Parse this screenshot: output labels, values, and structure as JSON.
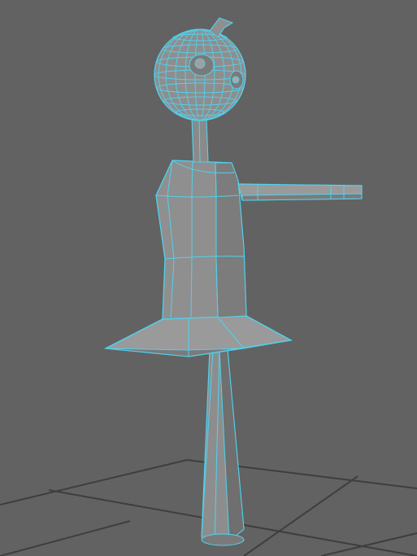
{
  "viewport": {
    "background": "#626262",
    "grid_color": "#3e3e3e",
    "wire_color": "#4fd3f0",
    "mesh_fill": "#8a8a8a",
    "mesh_fill_dark": "#7b7b7b",
    "mesh_fill_light": "#9a9a9a"
  },
  "scene": {
    "object": "character-model",
    "display_mode": "wireframe-on-shaded",
    "selected": true
  }
}
